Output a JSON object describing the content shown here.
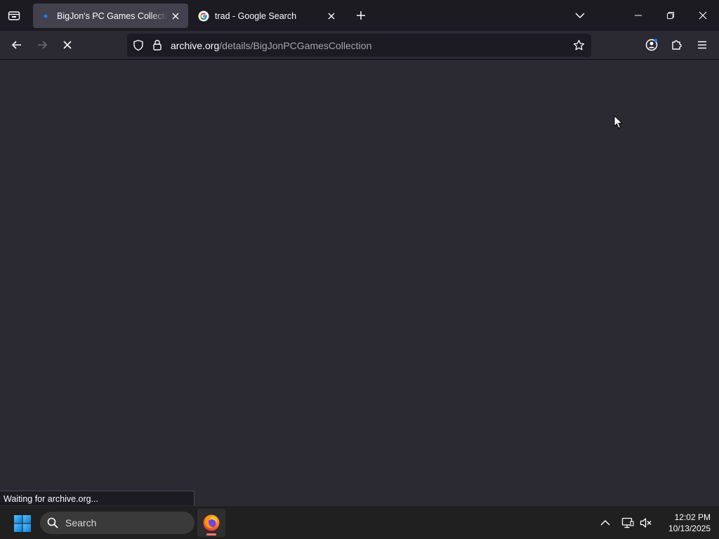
{
  "tabs": [
    {
      "title": "BigJon's PC Games Collection : Free",
      "active": true,
      "favicon": "loading-dot-icon"
    },
    {
      "title": "trad - Google Search",
      "active": false,
      "favicon": "google-icon"
    }
  ],
  "urlbar": {
    "host": "archive.org",
    "path": "/details/BigJonPCGamesCollection"
  },
  "status": {
    "text": "Waiting for archive.org..."
  },
  "taskbar": {
    "search_label": "Search",
    "time": "12:02 PM",
    "date": "10/13/2025"
  },
  "colors": {
    "accent": "#0a84ff",
    "toolbar": "#2b2a33",
    "tabstrip": "#1c1b22"
  }
}
